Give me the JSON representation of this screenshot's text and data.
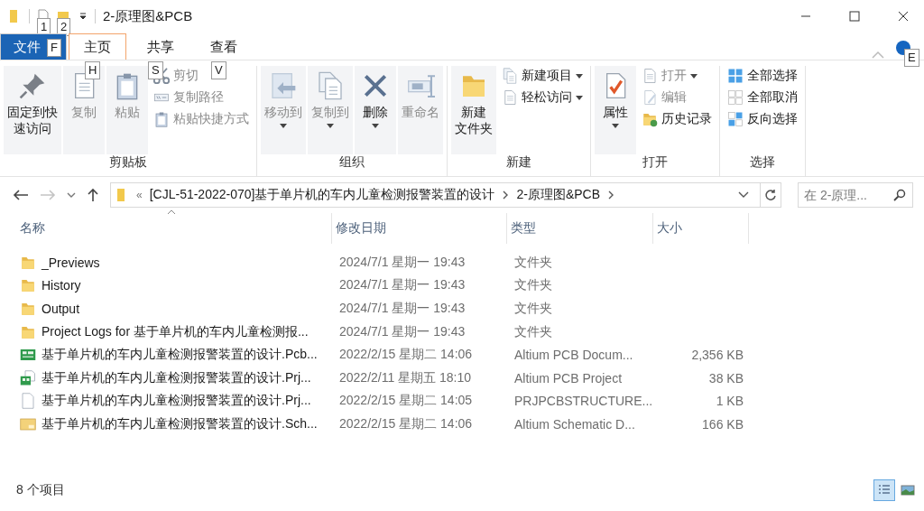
{
  "window": {
    "title": "2-原理图&PCB",
    "quick_access_keytips": [
      "1",
      "2"
    ]
  },
  "ribbon_tabs": [
    {
      "label": "文件",
      "kind": "file",
      "keytip": "F",
      "selected": false
    },
    {
      "label": "主页",
      "kind": "tab",
      "keytip": "H",
      "selected": true
    },
    {
      "label": "共享",
      "kind": "tab",
      "keytip": "S",
      "selected": false
    },
    {
      "label": "查看",
      "kind": "tab",
      "keytip": "V",
      "selected": false
    }
  ],
  "help_keytip": "E",
  "ribbon_groups": [
    {
      "label": "剪贴板",
      "large": [
        {
          "label_lines": [
            "固定到快",
            "速访问"
          ],
          "disabled": false,
          "menu": false
        },
        {
          "label_lines": [
            "复制"
          ],
          "disabled": true,
          "menu": false
        },
        {
          "label_lines": [
            "粘贴"
          ],
          "disabled": true,
          "menu": false
        }
      ],
      "small": [
        {
          "label": "剪切",
          "disabled": true,
          "menu": false
        },
        {
          "label": "复制路径",
          "disabled": true,
          "menu": false
        },
        {
          "label": "粘贴快捷方式",
          "disabled": true,
          "menu": false
        }
      ]
    },
    {
      "label": "组织",
      "large": [
        {
          "label_lines": [
            "移动到"
          ],
          "disabled": true,
          "menu": true
        },
        {
          "label_lines": [
            "复制到"
          ],
          "disabled": true,
          "menu": true
        },
        {
          "label_lines": [
            "删除"
          ],
          "disabled": false,
          "menu": true
        },
        {
          "label_lines": [
            "重命名"
          ],
          "disabled": true,
          "menu": false
        }
      ]
    },
    {
      "label": "新建",
      "large": [
        {
          "label_lines": [
            "新建",
            "文件夹"
          ],
          "disabled": false,
          "menu": false
        }
      ],
      "small": [
        {
          "label": "新建项目",
          "disabled": false,
          "menu": true
        },
        {
          "label": "轻松访问",
          "disabled": false,
          "menu": true
        }
      ]
    },
    {
      "label": "打开",
      "large": [
        {
          "label_lines": [
            "属性"
          ],
          "disabled": false,
          "menu": true
        }
      ],
      "small": [
        {
          "label": "打开",
          "disabled": true,
          "menu": true
        },
        {
          "label": "编辑",
          "disabled": true,
          "menu": false
        },
        {
          "label": "历史记录",
          "disabled": false,
          "menu": false
        }
      ]
    },
    {
      "label": "选择",
      "small": [
        {
          "label": "全部选择",
          "disabled": false,
          "menu": false
        },
        {
          "label": "全部取消",
          "disabled": false,
          "menu": false
        },
        {
          "label": "反向选择",
          "disabled": false,
          "menu": false
        }
      ]
    }
  ],
  "navigation": {
    "back_disabled": false,
    "forward_disabled": true
  },
  "address_bar": {
    "overflow": "«",
    "breadcrumbs": [
      "[CJL-51-2022-070]基于单片机的车内儿童检测报警装置的设计",
      "2-原理图&PCB"
    ]
  },
  "search": {
    "placeholder": "在 2-原理..."
  },
  "table": {
    "columns": [
      "名称",
      "修改日期",
      "类型",
      "大小"
    ],
    "rows": [
      {
        "kind": "folder",
        "name": "_Previews",
        "date": "2024/7/1 星期一 19:43",
        "type": "文件夹",
        "size": ""
      },
      {
        "kind": "folder",
        "name": "History",
        "date": "2024/7/1 星期一 19:43",
        "type": "文件夹",
        "size": ""
      },
      {
        "kind": "folder",
        "name": "Output",
        "date": "2024/7/1 星期一 19:43",
        "type": "文件夹",
        "size": ""
      },
      {
        "kind": "folder",
        "name": "Project Logs for 基于单片机的车内儿童检测报...",
        "date": "2024/7/1 星期一 19:43",
        "type": "文件夹",
        "size": ""
      },
      {
        "kind": "pcb",
        "name": "基于单片机的车内儿童检测报警装置的设计.Pcb...",
        "date": "2022/2/15 星期二 14:06",
        "type": "Altium PCB Docum...",
        "size": "2,356 KB"
      },
      {
        "kind": "project",
        "name": "基于单片机的车内儿童检测报警装置的设计.Prj...",
        "date": "2022/2/11 星期五 18:10",
        "type": "Altium PCB Project",
        "size": "38 KB"
      },
      {
        "kind": "file",
        "name": "基于单片机的车内儿童检测报警装置的设计.Prj...",
        "date": "2022/2/15 星期二 14:05",
        "type": "PRJPCBSTRUCTURE...",
        "size": "1 KB"
      },
      {
        "kind": "schematic",
        "name": "基于单片机的车内儿童检测报警装置的设计.Sch...",
        "date": "2022/2/15 星期二 14:06",
        "type": "Altium Schematic D...",
        "size": "166 KB"
      }
    ]
  },
  "status_bar": {
    "item_count": "8 个项目",
    "views": [
      {
        "kind": "details",
        "selected": true
      },
      {
        "kind": "large_icons",
        "selected": false
      }
    ]
  }
}
